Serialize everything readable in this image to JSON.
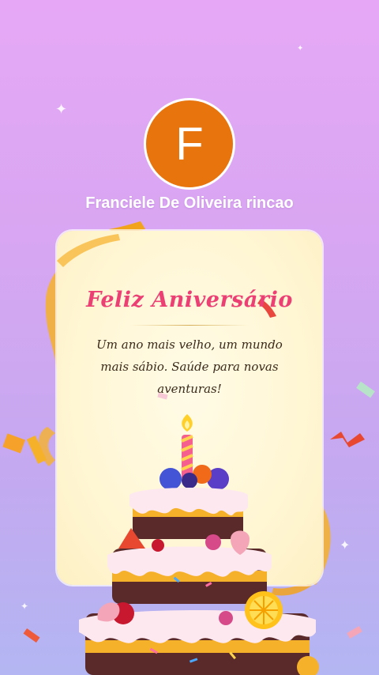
{
  "profile": {
    "avatar_letter": "F",
    "avatar_color": "#e8740d",
    "name": "Franciele De Oliveira rincao"
  },
  "card": {
    "title": "Feliz Aniversário",
    "message": "Um ano mais velho, um mundo mais sábio. Saúde para novas aventuras!"
  },
  "colors": {
    "background_top": "#e6a8f6",
    "background_bottom": "#b3b6f2",
    "title": "#ec3f74",
    "ribbon": "#f6b12a"
  },
  "decorations": {
    "cake_icon": "birthday-cake-icon",
    "sparkle_icon": "sparkle-icon",
    "ribbon_icon": "ribbon-icon",
    "confetti_icon": "confetti-icon"
  }
}
